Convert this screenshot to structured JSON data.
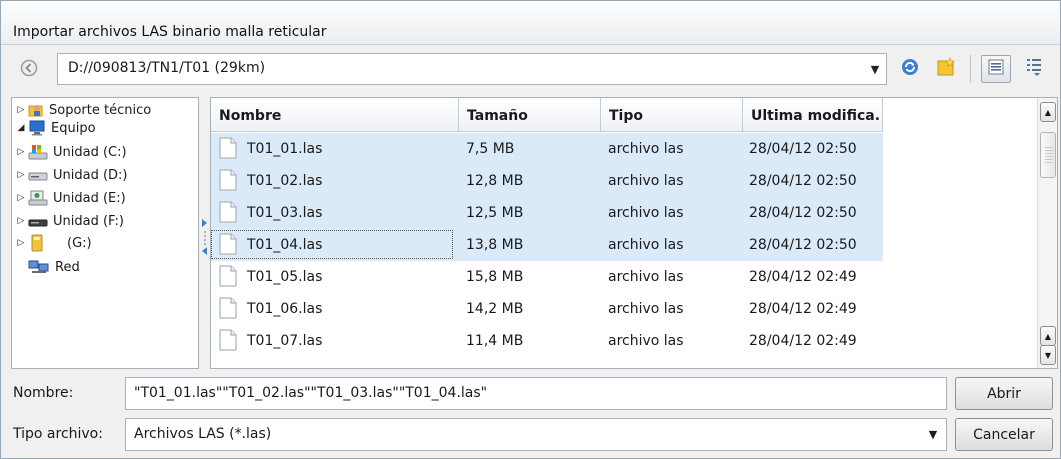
{
  "window": {
    "title": "Importar archivos LAS binario malla reticular"
  },
  "toolbar": {
    "path": "D://090813/TN1/T01 (29km)",
    "icons": {
      "back": "back-arrow-icon",
      "path_dropdown": "chevron-down-icon",
      "refresh": "refresh-icon",
      "new_folder": "new-folder-icon",
      "details_view": "details-view-icon",
      "list_view": "list-view-icon"
    },
    "accent_colors": {
      "refresh": "#3a7fd0",
      "new_folder": "#f3c531"
    }
  },
  "tree": {
    "items": [
      {
        "label": "Soporte técnico",
        "icon": "user-folder-icon",
        "expander": "collapsed"
      },
      {
        "label": "Equipo",
        "icon": "computer-icon",
        "expander": "expanded"
      },
      {
        "label": "Unidad (C:)",
        "icon": "system-drive-icon",
        "expander": "collapsed"
      },
      {
        "label": "Unidad (D:)",
        "icon": "hard-drive-icon",
        "expander": "collapsed"
      },
      {
        "label": "Unidad (E:)",
        "icon": "drive-icon",
        "expander": "collapsed"
      },
      {
        "label": "Unidad (F:)",
        "icon": "hard-drive-icon",
        "expander": "collapsed"
      },
      {
        "label": "(G:)",
        "icon": "usb-drive-icon",
        "expander": "collapsed"
      },
      {
        "label": "Red",
        "icon": "network-icon",
        "expander": "none"
      }
    ]
  },
  "files": {
    "columns": [
      "Nombre",
      "Tamaño",
      "Tipo",
      "Ultima modifica."
    ],
    "rows": [
      {
        "name": "T01_01.las",
        "size": "7,5 MB",
        "type": "archivo las",
        "modified": "28/04/12 02:50",
        "selected": true
      },
      {
        "name": "T01_02.las",
        "size": "12,8 MB",
        "type": "archivo las",
        "modified": "28/04/12 02:50",
        "selected": true
      },
      {
        "name": "T01_03.las",
        "size": "12,5 MB",
        "type": "archivo las",
        "modified": "28/04/12 02:50",
        "selected": true
      },
      {
        "name": "T01_04.las",
        "size": "13,8 MB",
        "type": "archivo las",
        "modified": "28/04/12 02:50",
        "selected": true
      },
      {
        "name": "T01_05.las",
        "size": "15,8 MB",
        "type": "archivo las",
        "modified": "28/04/12 02:49",
        "selected": false
      },
      {
        "name": "T01_06.las",
        "size": "14,2 MB",
        "type": "archivo las",
        "modified": "28/04/12 02:49",
        "selected": false
      },
      {
        "name": "T01_07.las",
        "size": "11,4 MB",
        "type": "archivo las",
        "modified": "28/04/12 02:49",
        "selected": false
      }
    ],
    "selection_color": "#dbeaf8",
    "file_icon": "document-icon"
  },
  "form": {
    "name_label": "Nombre:",
    "name_value": "\"T01_01.las\"\"T01_02.las\"\"T01_03.las\"\"T01_04.las\"",
    "type_label": "Tipo archivo:",
    "type_value": "Archivos LAS (*.las)",
    "open_label": "Abrir",
    "cancel_label": "Cancelar"
  }
}
